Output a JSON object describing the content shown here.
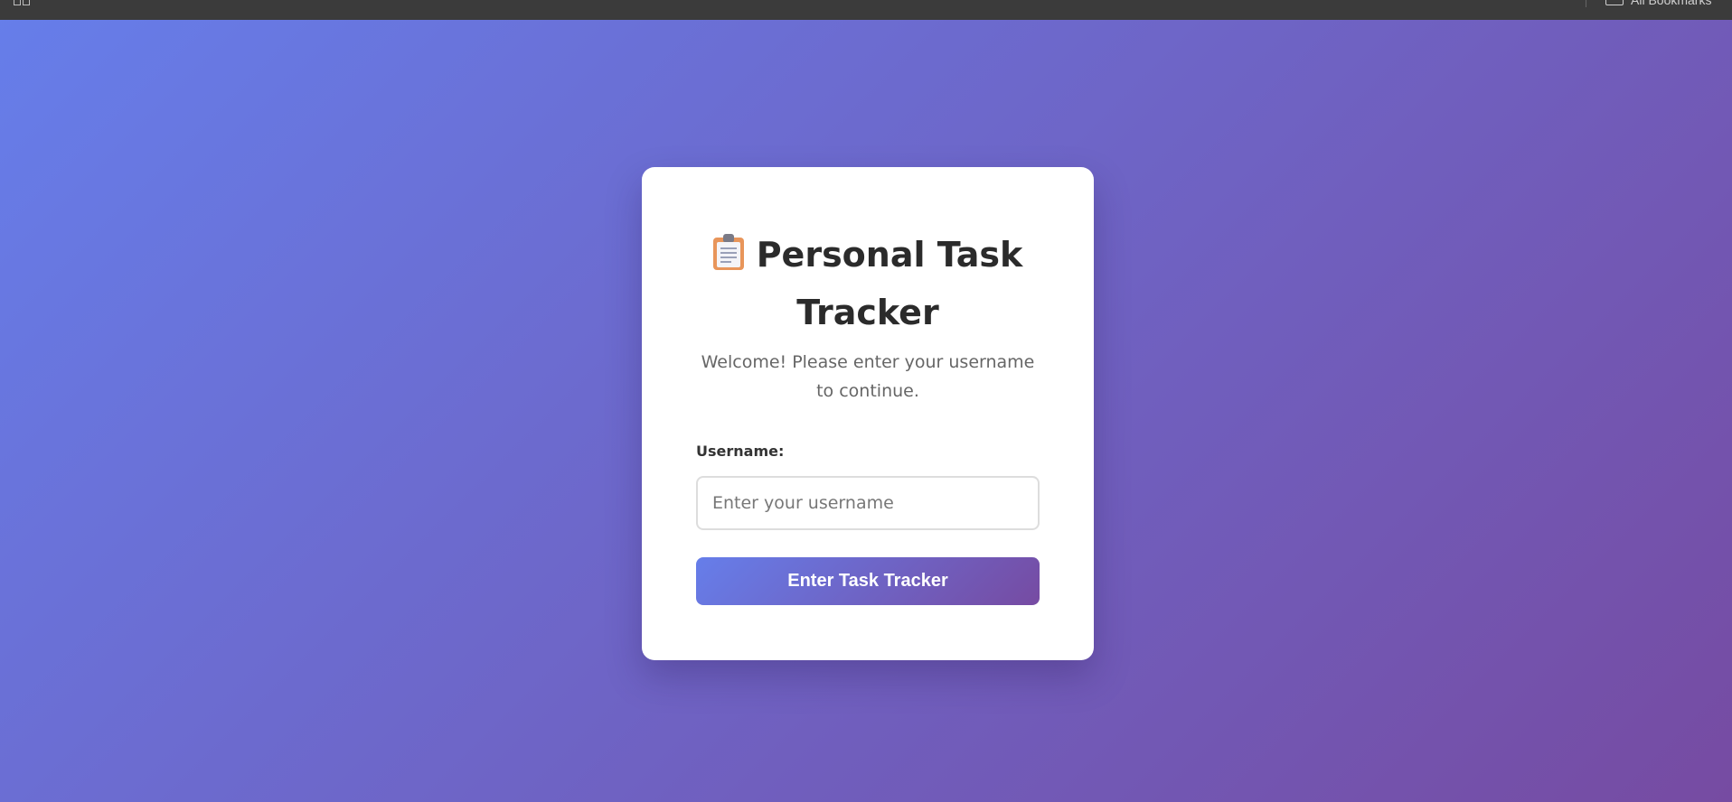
{
  "browser": {
    "bookmarks_label": "All Bookmarks"
  },
  "login": {
    "title": "Personal Task Tracker",
    "title_icon": "clipboard-icon",
    "subtitle": "Welcome! Please enter your username to continue.",
    "username_label": "Username:",
    "username_value": "",
    "username_placeholder": "Enter your username",
    "submit_label": "Enter Task Tracker"
  },
  "colors": {
    "gradient_start": "#667eea",
    "gradient_end": "#764ba2",
    "card_background": "#ffffff",
    "title_text": "#2b2b2b",
    "subtitle_text": "#666666"
  }
}
